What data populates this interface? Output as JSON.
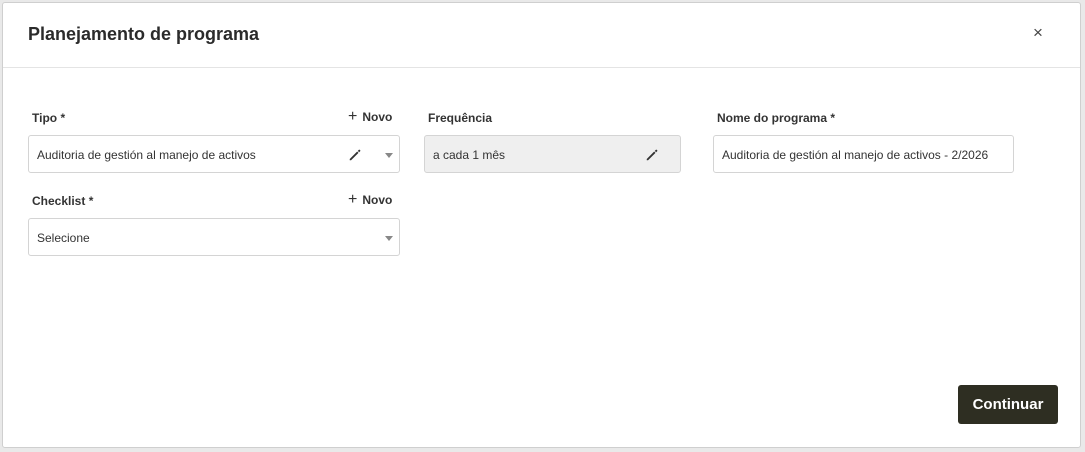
{
  "dialog": {
    "title": "Planejamento de programa",
    "close_label": "×"
  },
  "tipo": {
    "label": "Tipo *",
    "new_label": "Novo",
    "value": "Auditoria de gestión al manejo de activos"
  },
  "frequencia": {
    "label": "Frequência",
    "value": "a cada 1 mês"
  },
  "nome_programa": {
    "label": "Nome do programa *",
    "value": "Auditoria de gestión al manejo de activos - 2/2026"
  },
  "checklist": {
    "label": "Checklist *",
    "new_label": "Novo",
    "value": "Selecione"
  },
  "actions": {
    "continue_label": "Continuar"
  },
  "icons": {
    "close": "close-icon",
    "plus": "plus-icon",
    "edit": "pencil-icon",
    "dropdown": "caret-down-icon"
  },
  "colors": {
    "primary_button": "#2e2e22",
    "readonly_field": "#efefef"
  }
}
